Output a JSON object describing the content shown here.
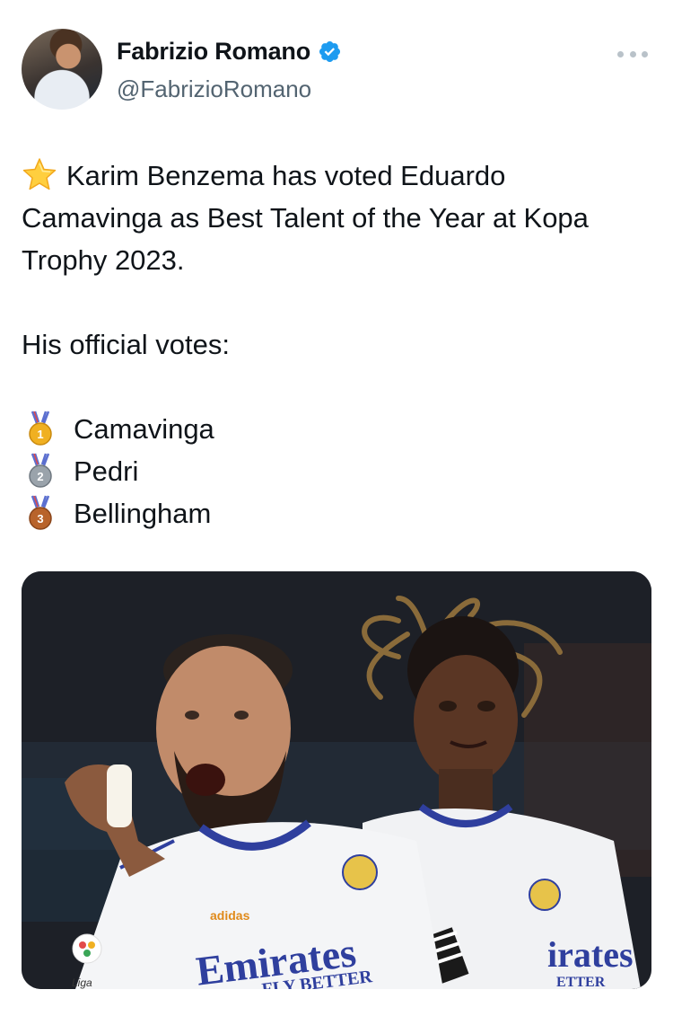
{
  "author": {
    "display_name": "Fabrizio Romano",
    "handle": "@FabrizioRomano",
    "verified": true,
    "verified_color": "#1d9bf0",
    "avatar_icon": "profile-avatar"
  },
  "tweet": {
    "line1": "Karim Benzema has voted Eduardo",
    "line2": "Camavinga as Best Talent of the Year at Kopa",
    "line3": "Trophy 2023.",
    "line4": "His official votes:",
    "votes": [
      {
        "rank": "1",
        "medal": "gold-medal-icon",
        "name": "Camavinga"
      },
      {
        "rank": "2",
        "medal": "silver-medal-icon",
        "name": "Pedri"
      },
      {
        "rank": "3",
        "medal": "bronze-medal-icon",
        "name": "Bellingham"
      }
    ]
  },
  "media": {
    "image": "photo of two Real Madrid players celebrating",
    "shirt_text_left": "Emirates",
    "shirt_text_left_sub": "FLY BETTER",
    "shirt_text_right": "irates",
    "shirt_text_right_sub": "ETTER",
    "brand_text": "adidas",
    "league_text": "Liga"
  }
}
